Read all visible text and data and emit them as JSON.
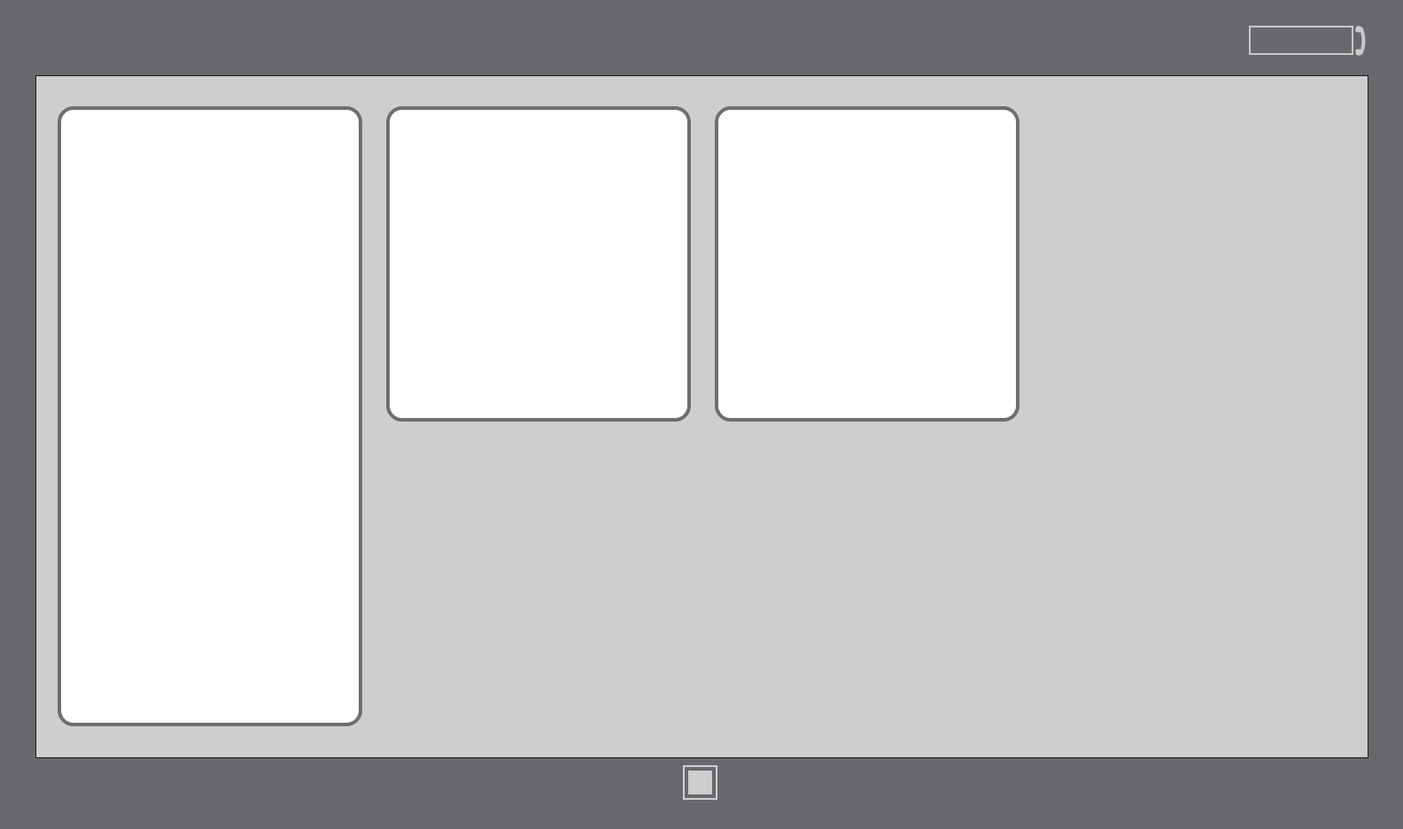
{
  "canvas": {
    "cards": [
      {
        "kind": "tall"
      },
      {
        "kind": "short"
      },
      {
        "kind": "short"
      }
    ]
  }
}
